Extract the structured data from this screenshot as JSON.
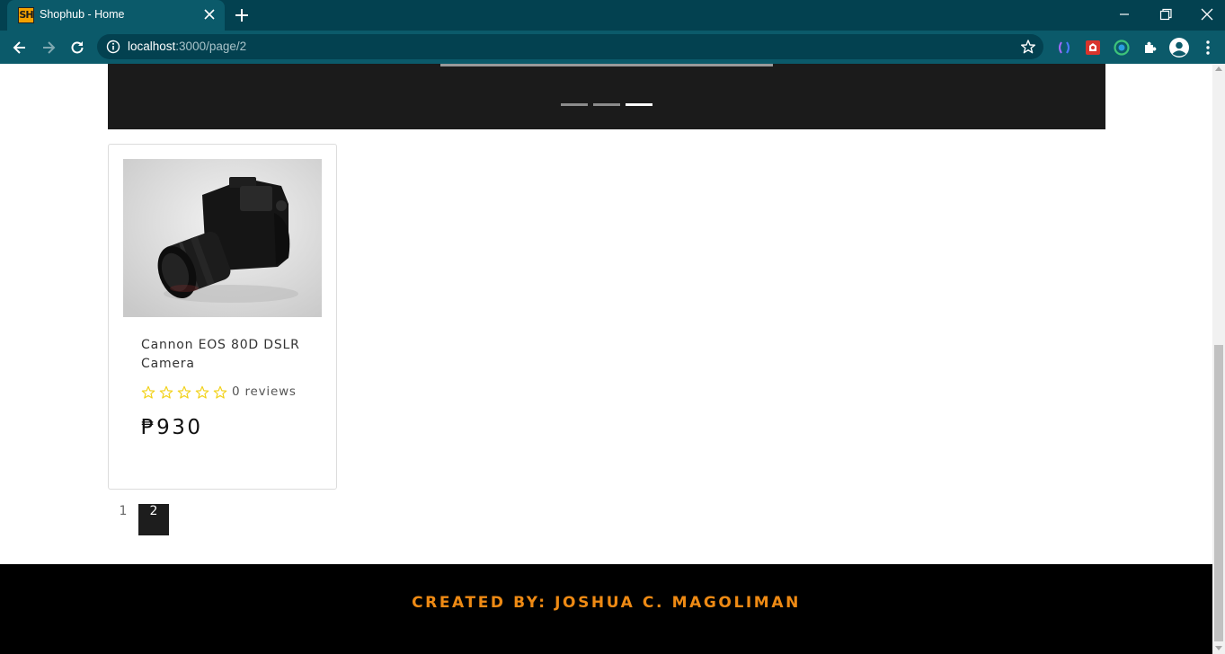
{
  "browser": {
    "tab": {
      "favicon_text": "SH",
      "title": "Shophub - Home"
    },
    "url": {
      "host": "localhost",
      "rest": ":3000/page/2"
    },
    "icons": [
      "back-icon",
      "forward-icon",
      "reload-icon",
      "site-info-icon",
      "bookmark-star-icon",
      "extension-icon",
      "profile-icon",
      "menu-icon"
    ]
  },
  "carousel": {
    "indicator_count": 3,
    "active_index": 2
  },
  "products": [
    {
      "name": "Cannon EOS 80D DSLR Camera",
      "rating": 0,
      "max_rating": 5,
      "reviews": "0 reviews",
      "price": "₱930"
    }
  ],
  "pagination": {
    "pages": [
      "1",
      "2"
    ],
    "current": "2"
  },
  "footer": {
    "credit": "CREATED BY: JOSHUA C. MAGOLIMAN"
  },
  "colors": {
    "chrome_dark": "#034150",
    "chrome": "#0b5a6a",
    "footer_text": "#ee8a14",
    "star": "#f2d21b"
  }
}
